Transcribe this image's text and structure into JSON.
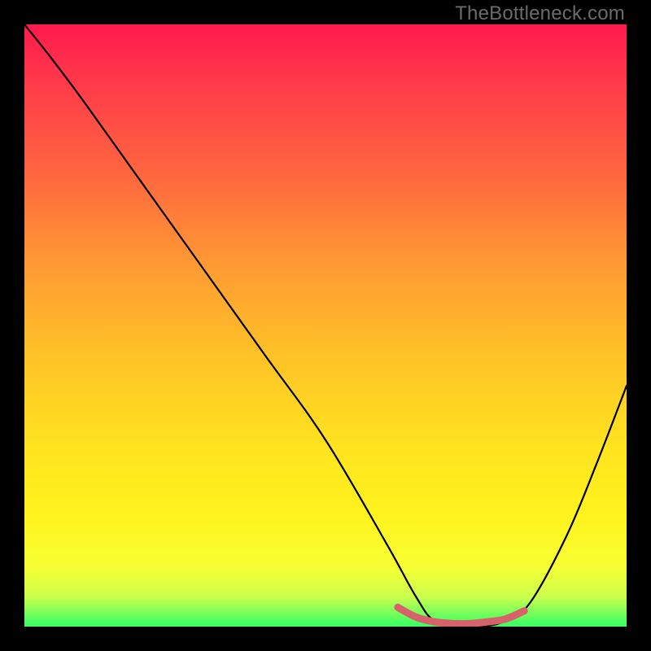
{
  "watermark": "TheBottleneck.com",
  "chart_data": {
    "type": "line",
    "title": "",
    "xlabel": "",
    "ylabel": "",
    "xlim": [
      0,
      100
    ],
    "ylim": [
      0,
      100
    ],
    "series": [
      {
        "name": "bottleneck-curve",
        "x": [
          0,
          4,
          10,
          20,
          30,
          40,
          50,
          60,
          65,
          68,
          72,
          76,
          80,
          84,
          90,
          95,
          100
        ],
        "y": [
          100,
          95,
          87,
          73,
          59,
          45,
          31,
          14,
          5,
          1,
          0,
          0,
          1,
          4,
          15,
          27,
          40
        ]
      },
      {
        "name": "bottom-marker",
        "x": [
          62,
          65,
          68,
          71,
          74,
          77,
          80,
          83
        ],
        "y": [
          3.2,
          1.6,
          0.8,
          0.5,
          0.5,
          0.8,
          1.3,
          2.6
        ]
      }
    ],
    "gradient_stops": [
      {
        "pos": 0,
        "color": "#ff1a4d"
      },
      {
        "pos": 10,
        "color": "#ff3b4a"
      },
      {
        "pos": 26,
        "color": "#ff6a3e"
      },
      {
        "pos": 40,
        "color": "#ff9a33"
      },
      {
        "pos": 55,
        "color": "#ffc227"
      },
      {
        "pos": 70,
        "color": "#ffe31f"
      },
      {
        "pos": 82,
        "color": "#fff41e"
      },
      {
        "pos": 90,
        "color": "#f7ff33"
      },
      {
        "pos": 95,
        "color": "#ccff4d"
      },
      {
        "pos": 100,
        "color": "#33ff66"
      }
    ],
    "marker_color": "#d9616b"
  }
}
